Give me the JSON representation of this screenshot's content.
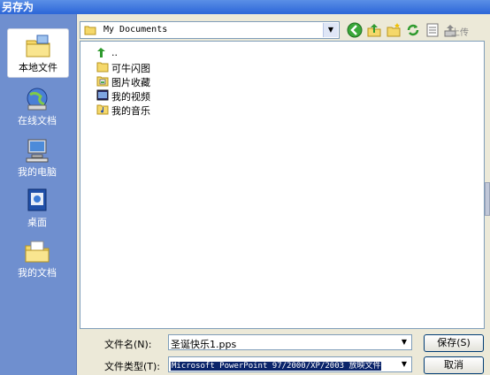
{
  "window": {
    "title": "另存为"
  },
  "places": [
    {
      "label": "本地文件",
      "icon": "local-files-icon"
    },
    {
      "label": "在线文档",
      "icon": "online-docs-icon"
    },
    {
      "label": "我的电脑",
      "icon": "my-computer-icon"
    },
    {
      "label": "桌面",
      "icon": "desktop-icon"
    },
    {
      "label": "我的文档",
      "icon": "my-documents-icon"
    }
  ],
  "lookin": {
    "value": "My Documents"
  },
  "toolbar": {
    "upload_label": "上传"
  },
  "files": {
    "up": "..",
    "items": [
      {
        "name": "可牛闪图",
        "icon": "folder-icon"
      },
      {
        "name": "图片收藏",
        "icon": "pictures-folder-icon"
      },
      {
        "name": "我的视频",
        "icon": "videos-folder-icon"
      },
      {
        "name": "我的音乐",
        "icon": "music-folder-icon"
      }
    ]
  },
  "form": {
    "filename_label": "文件名(N):",
    "filename_value": "圣诞快乐1.pps",
    "filetype_label": "文件类型(T):",
    "filetype_value": "Microsoft PowerPoint 97/2000/XP/2003 放映文件",
    "save_label": "保存(S)",
    "cancel_label": "取消"
  }
}
